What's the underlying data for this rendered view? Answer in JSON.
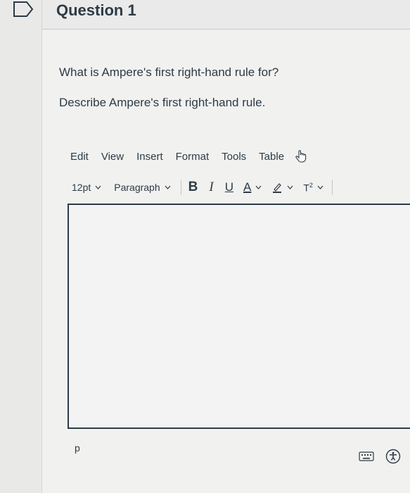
{
  "question": {
    "title": "Question 1",
    "lines": [
      "What is Ampere's first right-hand rule for?",
      "Describe Ampere's first right-hand rule."
    ]
  },
  "editor": {
    "menu": [
      "Edit",
      "View",
      "Insert",
      "Format",
      "Tools",
      "Table"
    ],
    "font_size": "12pt",
    "block_format": "Paragraph",
    "bold": "B",
    "italic": "I",
    "underline": "U",
    "text_color": "A",
    "superscript": "T",
    "superscript_mark": "2",
    "status_path": "p"
  },
  "colors": {
    "text": "#2d3b45",
    "flag_border": "#2d3b45"
  },
  "icons": [
    "flag-icon",
    "hand-pointer-icon",
    "chevron-down-icon",
    "highlighter-icon",
    "keyboard-icon",
    "accessibility-icon"
  ]
}
